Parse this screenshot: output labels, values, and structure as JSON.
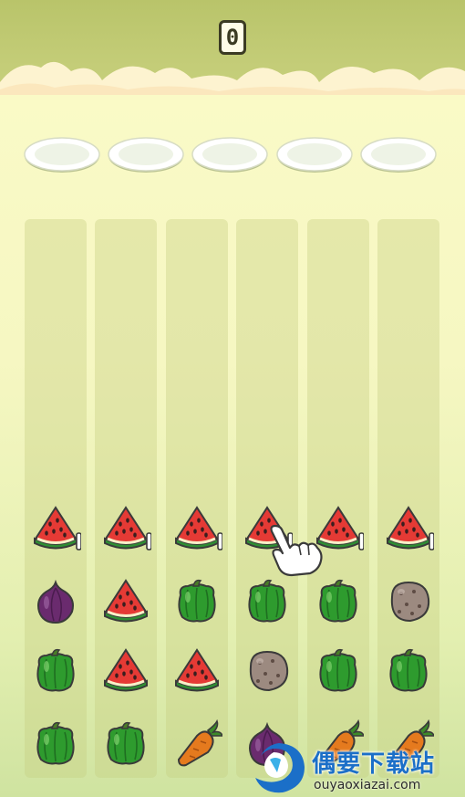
{
  "score": {
    "value": "0"
  },
  "plates": {
    "count": 5
  },
  "columns": [
    [
      "watermelon-stacked",
      "onion",
      "pepper",
      "pepper"
    ],
    [
      "watermelon-stacked",
      "watermelon",
      "watermelon",
      "pepper"
    ],
    [
      "watermelon-stacked",
      "pepper",
      "watermelon",
      "carrot"
    ],
    [
      "watermelon-stacked",
      "pepper",
      "potato",
      "onion"
    ],
    [
      "watermelon-stacked",
      "pepper",
      "pepper",
      "carrot"
    ],
    [
      "watermelon-stacked",
      "potato",
      "pepper",
      "carrot"
    ]
  ],
  "hint": {
    "icon": "pointing-hand-icon"
  },
  "watermark": {
    "title": "偶要下载站",
    "url": "ouyaoxiazai.com"
  },
  "colors": {
    "topbar": "#b9c46a",
    "background": "#fbfbc8",
    "column": "#dfe6a4",
    "watermelon_flesh": "#e53a35",
    "pepper": "#2e9b2e",
    "onion": "#6a2b6e",
    "carrot": "#e57a1e",
    "potato": "#9c8a80",
    "watermark_blue": "#1b6fc8"
  }
}
